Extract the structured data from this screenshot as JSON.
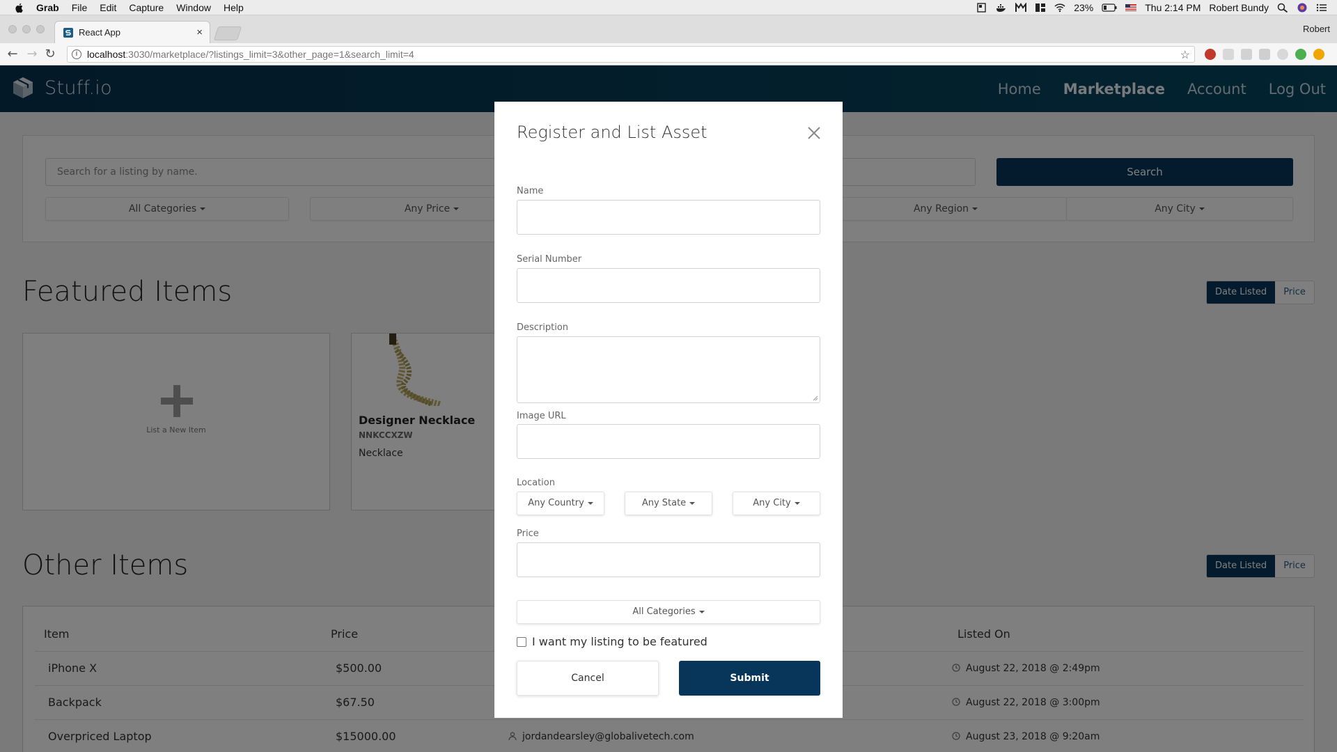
{
  "menubar": {
    "app": "Grab",
    "items": [
      "File",
      "Edit",
      "Capture",
      "Window",
      "Help"
    ],
    "battery": "23%",
    "clock": "Thu 2:14 PM",
    "user": "Robert Bundy"
  },
  "browser": {
    "tab_title": "React App",
    "profile": "Robert",
    "url_host": "localhost",
    "url_path": ":3030/marketplace/?listings_limit=3&other_page=1&search_limit=4"
  },
  "app": {
    "brand": "Stuff.io",
    "nav": [
      "Home",
      "Marketplace",
      "Account",
      "Log Out"
    ],
    "active_nav": "Marketplace",
    "accent": "#07365a"
  },
  "search": {
    "placeholder": "Search for a listing by name.",
    "button": "Search",
    "filters": [
      "All Categories",
      "Any Price",
      "Any Region",
      "Any City"
    ]
  },
  "featured": {
    "title": "Featured Items",
    "sort": [
      "Date Listed",
      "Price"
    ],
    "add_label": "List a New Item",
    "item": {
      "name": "Designer Necklace",
      "serial": "NNKCCXZW",
      "category": "Necklace"
    }
  },
  "other": {
    "title": "Other Items",
    "sort": [
      "Date Listed",
      "Price"
    ],
    "columns": [
      "Item",
      "Price",
      "Listed On"
    ],
    "rows": [
      {
        "item": "iPhone X",
        "price": "$500.00",
        "seller": "",
        "listed": "August 22, 2018 @ 2:49pm"
      },
      {
        "item": "Backpack",
        "price": "$67.50",
        "seller": "",
        "listed": "August 22, 2018 @ 3:00pm"
      },
      {
        "item": "Overpriced Laptop",
        "price": "$15000.00",
        "seller": "jordandearsley@globalivetech.com",
        "listed": "August 23, 2018 @ 9:20am"
      }
    ]
  },
  "modal": {
    "title": "Register and List Asset",
    "labels": {
      "name": "Name",
      "serial": "Serial Number",
      "description": "Description",
      "image": "Image URL",
      "location": "Location",
      "price": "Price"
    },
    "location_options": [
      "Any Country",
      "Any State",
      "Any City"
    ],
    "category": "All Categories",
    "featured_label": "I want my listing to be featured",
    "featured_checked": false,
    "cancel": "Cancel",
    "submit": "Submit"
  }
}
